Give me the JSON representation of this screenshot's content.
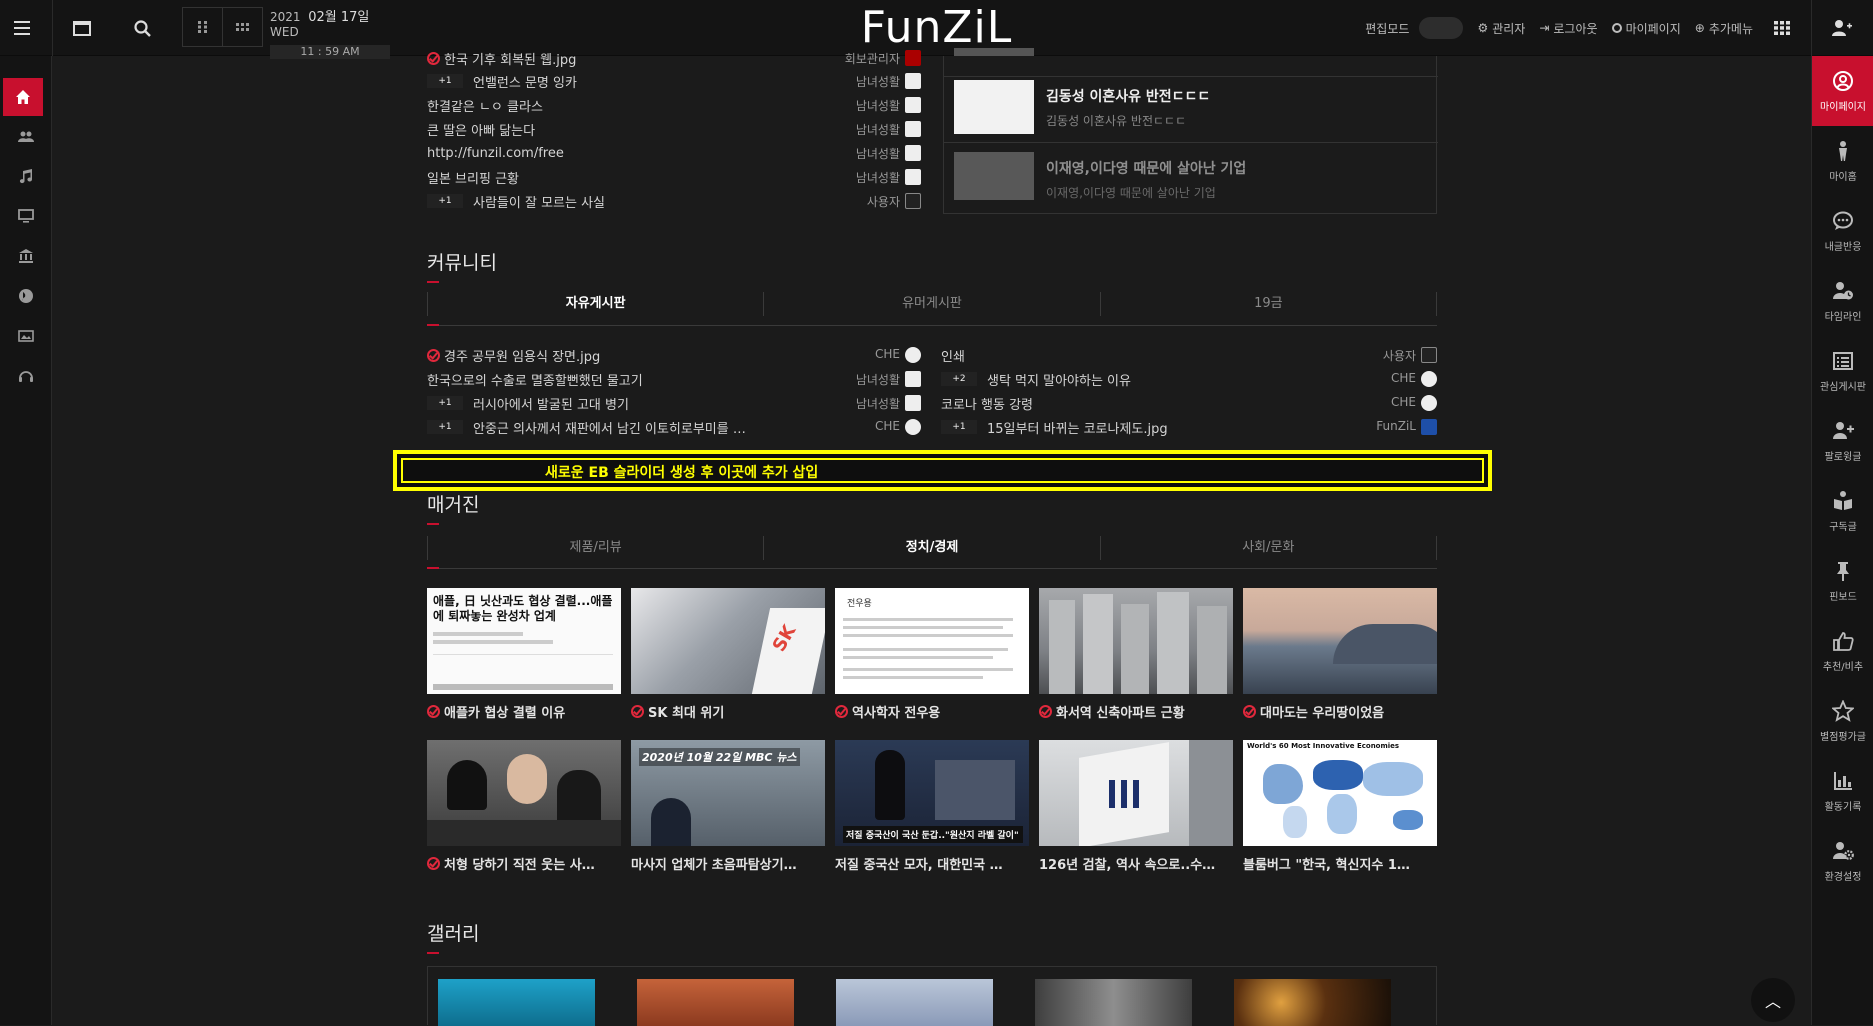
{
  "topbar": {
    "logo": "FunZiL",
    "date_year": "2021",
    "date_md": "02월 17일",
    "date_wd": "WED",
    "time": "11 : 59 AM",
    "edit_mode": "편집모드",
    "admin": "관리자",
    "logout": "로그아웃",
    "mypage": "마이페이지",
    "addmenu": "추가메뉴"
  },
  "left_sidebar": [
    "home-icon",
    "users-icon",
    "music-icon",
    "monitor-icon",
    "bank-icon",
    "globe-icon",
    "photo-icon",
    "headset-icon"
  ],
  "right_sidebar": [
    {
      "label": "마이페이지",
      "icon": "user-circle-icon"
    },
    {
      "label": "마이홈",
      "icon": "person-icon"
    },
    {
      "label": "내글반응",
      "icon": "chat-icon"
    },
    {
      "label": "타임라인",
      "icon": "user-clock-icon"
    },
    {
      "label": "관심게시판",
      "icon": "list-icon"
    },
    {
      "label": "팔로윙글",
      "icon": "user-plus-icon"
    },
    {
      "label": "구독글",
      "icon": "book-icon"
    },
    {
      "label": "핀보드",
      "icon": "pin-icon"
    },
    {
      "label": "추천/비추",
      "icon": "thumb-icon"
    },
    {
      "label": "별점평가글",
      "icon": "star-icon"
    },
    {
      "label": "활동기록",
      "icon": "chart-icon"
    },
    {
      "label": "환경설정",
      "icon": "user-cog-icon"
    }
  ],
  "top_list": [
    {
      "title": "한국 기후 회복된 웹.jpg",
      "author": "회보관리자",
      "badge": "",
      "check": true
    },
    {
      "title": "언밸런스 문명 잉카",
      "author": "남녀성활",
      "badge": "+1",
      "check": false
    },
    {
      "title": "한결같은 ㄴㅇ 클라스",
      "author": "남녀성활",
      "badge": "",
      "check": false
    },
    {
      "title": "큰 딸은 아빠 닮는다",
      "author": "남녀성활",
      "badge": "",
      "check": false
    },
    {
      "title": "http://funzil.com/free",
      "author": "남녀성활",
      "badge": "",
      "check": false
    },
    {
      "title": "일본 브리핑 근황",
      "author": "남녀성활",
      "badge": "",
      "check": false
    },
    {
      "title": "사람들이 잘 모르는 사실",
      "author": "사용자",
      "badge": "+1",
      "check": false
    }
  ],
  "news_cards": [
    {
      "title": "김동성 이혼사유 반전ㄷㄷㄷ",
      "sub": "김동성 이혼사유 반전ㄷㄷㄷ"
    },
    {
      "title": "이재영,이다영 때문에 살아난 기업",
      "sub": "이재영,이다영 때문에 살아난 기업"
    }
  ],
  "community": {
    "title": "커뮤니티",
    "tabs": [
      "자유게시판",
      "유머게시판",
      "19금"
    ],
    "left": [
      {
        "title": "경주 공무원 임용식 장면.jpg",
        "author": "CHE",
        "badge": "",
        "check": true
      },
      {
        "title": "한국으로의 수출로 멸종할뻔했던 물고기",
        "author": "남녀성활",
        "badge": "",
        "check": false
      },
      {
        "title": "러시아에서 발굴된 고대 병기",
        "author": "남녀성활",
        "badge": "+1",
        "check": false
      },
      {
        "title": "안중근 의사께서 재판에서 남긴 이토히로부미를 …",
        "author": "CHE",
        "badge": "+1",
        "check": false
      }
    ],
    "right": [
      {
        "title": "인쇄",
        "author": "사용자",
        "badge": "",
        "check": false
      },
      {
        "title": "생탁 먹지 말아야하는 이유",
        "author": "CHE",
        "badge": "+2",
        "check": false
      },
      {
        "title": "코로나 행동 강령",
        "author": "CHE",
        "badge": "",
        "check": false
      },
      {
        "title": "15일부터 바뀌는 코로나제도.jpg",
        "author": "FunZiL",
        "badge": "+1",
        "check": false
      }
    ]
  },
  "banner": "새로운 EB 슬라이더 생성 후 이곳에 추가 삽입",
  "magazine": {
    "title": "매거진",
    "tabs": [
      "제품/리뷰",
      "정치/경제",
      "사회/문화"
    ],
    "row1": [
      {
        "caption": "애플카 협상 결렬 이유",
        "check": true,
        "thumb_text": "애플, 日 닛산과도 협상 결렬...애플에 퇴짜놓는 완성차 업계"
      },
      {
        "caption": "SK 최대 위기",
        "check": true,
        "thumb_text": ""
      },
      {
        "caption": "역사학자 전우용",
        "check": true,
        "thumb_text": "전우용"
      },
      {
        "caption": "화서역 신축아파트 근황",
        "check": true,
        "thumb_text": ""
      },
      {
        "caption": "대마도는 우리땅이었음",
        "check": true,
        "thumb_text": ""
      }
    ],
    "row2": [
      {
        "caption": "처형 당하기 직전 웃는 사…",
        "check": true,
        "thumb_text": ""
      },
      {
        "caption": "마사지 업체가 초음파탐상기…",
        "check": false,
        "thumb_text": "2020년 10월 22일 MBC 뉴스"
      },
      {
        "caption": "저질 중국산 모자, 대한민국 …",
        "check": false,
        "thumb_text": "저질 중국산이 국산 둔갑..\"원산지 라벨 갈이\""
      },
      {
        "caption": "126년 검찰, 역사 속으로..수…",
        "check": false,
        "thumb_text": ""
      },
      {
        "caption": "블룸버그 \"한국, 혁신지수 1…",
        "check": false,
        "thumb_text": "World's 60 Most Innovative Economies"
      }
    ]
  },
  "gallery": {
    "title": "갤러리"
  },
  "colors": {
    "accent": "#c8102e",
    "banner": "#ffff00",
    "bg": "#1b1b1b"
  }
}
